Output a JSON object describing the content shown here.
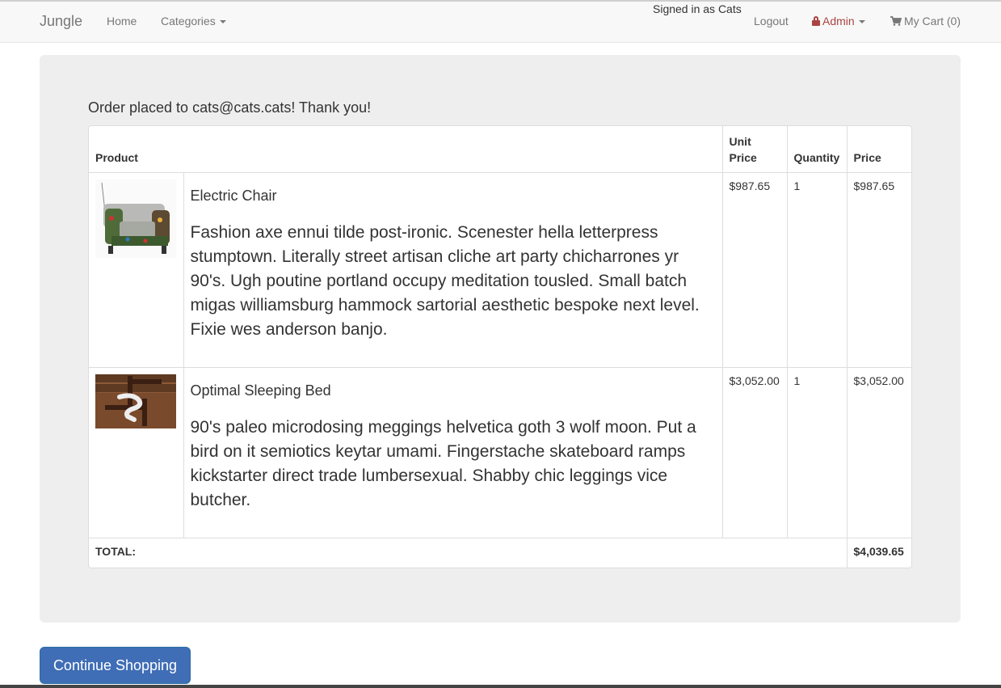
{
  "navbar": {
    "brand": "Jungle",
    "home": "Home",
    "categories": "Categories",
    "signed_in": "Signed in as Cats",
    "logout": "Logout",
    "admin": "Admin",
    "cart": "My Cart (0)"
  },
  "order": {
    "message": "Order placed to cats@cats.cats! Thank you!",
    "columns": {
      "product": "Product",
      "unit_price": "Unit Price",
      "quantity": "Quantity",
      "price": "Price"
    },
    "items": [
      {
        "name": "Electric Chair",
        "description": "Fashion axe ennui tilde post-ironic. Scenester hella letterpress stumptown. Literally street artisan cliche art party chicharrones yr 90's. Ugh poutine portland occupy meditation tousled. Small batch migas williamsburg hammock sartorial aesthetic bespoke next level. Fixie wes anderson banjo.",
        "unit_price": "$987.65",
        "quantity": "1",
        "price": "$987.65"
      },
      {
        "name": "Optimal Sleeping Bed",
        "description": "90's paleo microdosing meggings helvetica goth 3 wolf moon. Put a bird on it semiotics keytar umami. Fingerstache skateboard ramps kickstarter direct trade lumbersexual. Shabby chic leggings vice butcher.",
        "unit_price": "$3,052.00",
        "quantity": "1",
        "price": "$3,052.00"
      }
    ],
    "total_label": "TOTAL:",
    "total_value": "$4,039.65"
  },
  "continue_button": "Continue Shopping",
  "colors": {
    "primary": "#3f6db6",
    "admin": "#a94442",
    "jumbotron": "#eeeeee"
  }
}
